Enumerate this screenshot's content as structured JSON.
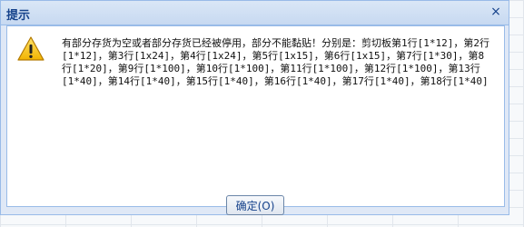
{
  "dialog": {
    "title": "提示",
    "close_icon": "×",
    "message": "有部分存货为空或者部分存货已经被停用，部分不能黏贴！分别是：剪切板第1行[1*12]，第2行[1*12]，第3行[1x24]，第4行[1x24]，第5行[1x15]，第6行[1x15]，第7行[1*30]，第8行[1*20]，第9行[1*100]，第10行[1*100]，第11行[1*100]，第12行[1*100]，第13行[1*40]，第14行[1*40]，第15行[1*40]，第16行[1*40]，第17行[1*40]，第18行[1*40]",
    "ok_button": "确定(O)",
    "icon": "warning-triangle-icon"
  }
}
